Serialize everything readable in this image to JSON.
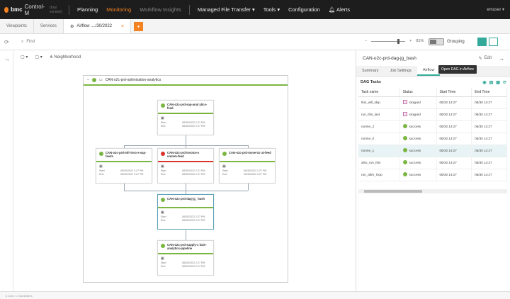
{
  "brand": {
    "bmc": "bmc",
    "product": "Control-M",
    "version": "(trial version)"
  },
  "nav": {
    "items": [
      {
        "label": "Planning",
        "state": "normal"
      },
      {
        "label": "Monitoring",
        "state": "active"
      },
      {
        "label": "Workflow Insights",
        "state": "dim"
      },
      {
        "label": "Managed File Transfer ▾",
        "state": "normal"
      },
      {
        "label": "Tools ▾",
        "state": "normal"
      },
      {
        "label": "Configuration",
        "state": "normal"
      },
      {
        "label": "Alerts",
        "state": "normal"
      }
    ],
    "user": "emuser ▾"
  },
  "tabs": {
    "viewpoints": "Viewpoints",
    "services": "Services",
    "active": "Airflow ..../30/2022",
    "close": "×",
    "add": "+"
  },
  "search": {
    "placeholder": "Find"
  },
  "zoom": {
    "value": "81%",
    "fraction": 0.81
  },
  "grouping": {
    "label": "Grouping"
  },
  "canvas_toolbar": {
    "neighborhood": "Neighborhood"
  },
  "flow": {
    "title": "CAN-o2c-prd-optimisation-analytics"
  },
  "jobs": [
    {
      "name": "CAN-o2c-prd-sap-anal ytics-feed",
      "status": "ok",
      "start": "08/30/2022 2:27 PM",
      "end": "08/30/2022 2:27 PM"
    },
    {
      "name": "CAN-o2c-prd-mfr-invo e-sap-feeds",
      "status": "ok",
      "start": "08/30/2022 2:27 PM",
      "end": "08/30/2022 2:27 PM"
    },
    {
      "name": "CAN-o2c-prd-invoice-s ummm-feed",
      "status": "fail",
      "start": "08/30/2022 2:27 PM",
      "end": "08/30/2022 2:27 PM"
    },
    {
      "name": "CAN-o2c-prd-move-tcr at-feed",
      "status": "ok",
      "start": "08/30/2022 2:27 PM",
      "end": "08/30/2022 2:27 PM"
    },
    {
      "name": "CAN-o2c-prd-dag-jg_ bash",
      "status": "ok",
      "start": "08/30/2022 2:27 PM",
      "end": "08/30/2022 2:27 PM"
    },
    {
      "name": "CAN-o2c-prd-supply-c hain-analytics-pipeline",
      "status": "ok",
      "start": "08/30/2022 2:27 PM",
      "end": "08/30/2022 2:27 PM"
    }
  ],
  "job_labels": {
    "start": "Start",
    "end": "End"
  },
  "panel": {
    "title": "CAN-o2c-prd-dag-jg_bash",
    "edit": "Edit",
    "tabs": [
      "Summary",
      "Job Settings",
      "Airflow"
    ],
    "tooltip": "Open DAG in Airflow",
    "section": "DAG Tasks",
    "columns": [
      "Task name",
      "Status",
      "Start Time",
      "End Time"
    ],
    "rows": [
      {
        "task": "this_will_skip",
        "status": "stopped",
        "start": "08/30 14:27",
        "end": "08/30 14:27"
      },
      {
        "task": "run_this_last",
        "status": "stopped",
        "start": "08/30 14:27",
        "end": "08/30 14:27"
      },
      {
        "task": "runme_2",
        "status": "success",
        "start": "08/30 14:27",
        "end": "08/30 14:27"
      },
      {
        "task": "runme_0",
        "status": "success",
        "start": "08/30 14:27",
        "end": "08/30 14:27"
      },
      {
        "task": "runme_1",
        "status": "success",
        "start": "08/30 14:27",
        "end": "08/30 14:27"
      },
      {
        "task": "also_run_this",
        "status": "success",
        "start": "08/30 14:27",
        "end": "08/30 14:27"
      },
      {
        "task": "run_after_loop",
        "status": "success",
        "start": "08/30 14:27",
        "end": "08/30 14:27"
      }
    ]
  },
  "statusbar": {
    "text": "6 Jobs / 1 Subfolders"
  },
  "colors": {
    "accent": "#f58220",
    "ok": "#7bb542",
    "fail": "#d9342b",
    "teal": "#33aa99"
  }
}
